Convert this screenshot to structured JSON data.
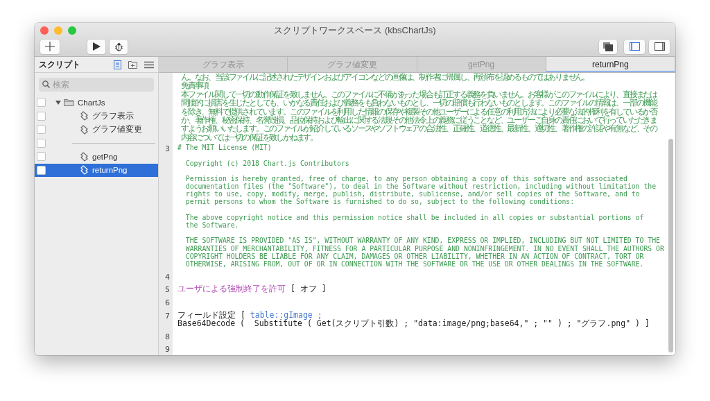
{
  "window": {
    "title": "スクリプトワークスペース (kbsChartJs)"
  },
  "sidebar": {
    "title": "スクリプト",
    "search": {
      "placeholder": "検索"
    },
    "items": [
      {
        "kind": "folder",
        "label": "ChartJs",
        "checked": false,
        "selected": false,
        "expanded": true,
        "children": [
          {
            "kind": "script",
            "label": "グラフ表示",
            "checked": false,
            "selected": false
          },
          {
            "kind": "script",
            "label": "グラフ値変更",
            "checked": false,
            "selected": false
          },
          {
            "kind": "separator",
            "checked": false,
            "selected": false
          },
          {
            "kind": "script",
            "label": "getPng",
            "checked": false,
            "selected": false
          },
          {
            "kind": "script",
            "label": "returnPng",
            "checked": false,
            "selected": true
          }
        ]
      }
    ]
  },
  "tabs": [
    {
      "label": "グラフ表示",
      "selected": false
    },
    {
      "label": "グラフ値変更",
      "selected": false
    },
    {
      "label": "getPng",
      "selected": false
    },
    {
      "label": "returnPng",
      "selected": true
    }
  ],
  "steps": [
    {
      "kind": "note",
      "paragraphs": [
        [
          "ん。なお、当該ファイルに記述されたデザインおよびアイコンなどの画像は、制作者に帰属し、再頒布を認めるものではありません。",
          "免責事項",
          "本ファイル関して一切の動作保証を致しません。このファイルに不備があった場合も訂正する義務を負いません。お客様がこのファイルにより、直接または",
          "間接的に損害を生じたとしても、いかなる責任および義務をも負わないものとし、一切の賠償も行わないものとします。このファイルの情報は、一部の機能",
          "を除き、無料で提供されています。このファイルを利用した情報の保存や複製その他ユーザーによる任意の利用方法により必要な法的権利を有しているか否",
          "か、著作権、秘密保持、名誉毀損、品位保持および輸出に関する法規その他法令上の義務に従うことなど、ユーザーご自身の責任において行っていただきま",
          "すようお願いいたします。このファイルが紹介しているソースやソフトウェアの合法性、正確性、道徳性、最新性、適切性、著作権の許諾や有無など、その",
          "内容については一切の保証を致しかねます。"
        ]
      ]
    },
    {
      "kind": "comment",
      "number": "3",
      "paragraphs": [
        [
          "# The MIT License (MIT)"
        ],
        [
          "  Copyright (c) 2018 Chart.js Contributors"
        ],
        [
          "  Permission is hereby granted, free of charge, to any person obtaining a copy of this software and associated",
          "  documentation files (the \"Software\"), to deal in the Software without restriction, including without limitation the",
          "  rights to use, copy, modify, merge, publish, distribute, sublicense, and/or sell copies of the Software, and to",
          "  permit persons to whom the Software is furnished to do so, subject to the following conditions:"
        ],
        [
          "  The above copyright notice and this permission notice shall be included in all copies or substantial portions of",
          "  the Software."
        ],
        [
          "  THE SOFTWARE IS PROVIDED \"AS IS\", WITHOUT WARRANTY OF ANY KIND, EXPRESS OR IMPLIED, INCLUDING BUT NOT LIMITED TO THE",
          "  WARRANTIES OF MERCHANTABILITY, FITNESS FOR A PARTICULAR PURPOSE AND NONINFRINGEMENT. IN NO EVENT SHALL THE AUTHORS OR",
          "  COPYRIGHT HOLDERS BE LIABLE FOR ANY CLAIM, DAMAGES OR OTHER LIABILITY, WHETHER IN AN ACTION OF CONTRACT, TORT OR",
          "  OTHERWISE, ARISING FROM, OUT OF OR IN CONNECTION WITH THE SOFTWARE OR THE USE OR OTHER DEALINGS IN THE SOFTWARE."
        ]
      ]
    },
    {
      "kind": "blank",
      "number": "4"
    },
    {
      "kind": "code",
      "number": "5",
      "lines": [
        [
          {
            "kind": "step",
            "text": "ユーザによる強制終了を許可"
          },
          {
            "kind": "plain",
            "text": " [ オフ ]"
          }
        ]
      ]
    },
    {
      "kind": "blank",
      "number": "6"
    },
    {
      "kind": "code",
      "number": "7",
      "lines": [
        [
          {
            "kind": "plain",
            "text": "フィールド設定 [ "
          },
          {
            "kind": "field",
            "text": "table::gImage ;"
          }
        ],
        [
          {
            "kind": "plain",
            "text": "Base64Decode (  Substitute ( Get(スクリプト引数) ; \"data:image/png;base64,\" ; \"\" ) ; \"グラフ.png\" ) ]"
          }
        ]
      ]
    },
    {
      "kind": "blank",
      "number": "8"
    },
    {
      "kind": "blank",
      "number": "9"
    }
  ]
}
